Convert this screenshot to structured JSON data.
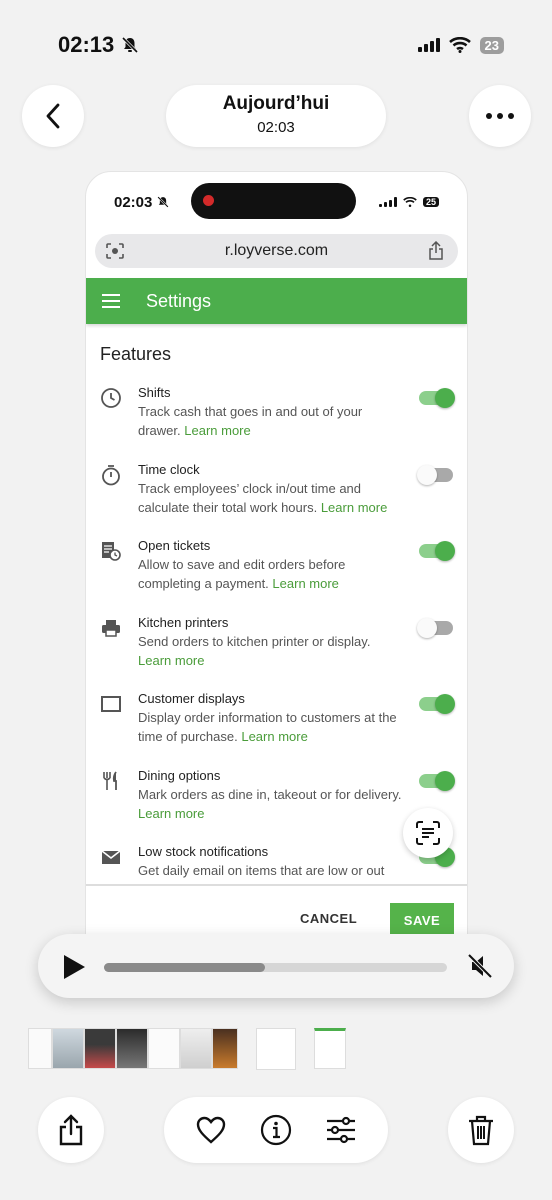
{
  "status_bar": {
    "time": "02:13",
    "battery": "23"
  },
  "header": {
    "title": "Aujourd’hui",
    "subtitle": "02:03"
  },
  "screenshot": {
    "status_bar": {
      "time": "02:03",
      "battery": "25"
    },
    "url": "r.loyverse.com",
    "appbar_title": "Settings",
    "section_title": "Features",
    "features": [
      {
        "name": "Shifts",
        "desc": "Track cash that goes in and out of your drawer.",
        "learn": "Learn more",
        "on": true,
        "icon": "clock-icon"
      },
      {
        "name": "Time clock",
        "desc": "Track employees’ clock in/out time and calculate their total work hours.",
        "learn": "Learn more",
        "on": false,
        "icon": "stopwatch-icon"
      },
      {
        "name": "Open tickets",
        "desc": "Allow to save and edit orders before completing a payment.",
        "learn": "Learn more",
        "on": true,
        "icon": "ticket-clock-icon"
      },
      {
        "name": "Kitchen printers",
        "desc": "Send orders to kitchen printer or display.",
        "learn": "Learn more",
        "on": false,
        "icon": "printer-icon"
      },
      {
        "name": "Customer displays",
        "desc": "Display order information to customers at the time of purchase.",
        "learn": "Learn more",
        "on": true,
        "icon": "display-icon"
      },
      {
        "name": "Dining options",
        "desc": "Mark orders as dine in, takeout or for delivery.",
        "learn": "Learn more",
        "on": true,
        "icon": "fork-knife-icon"
      },
      {
        "name": "Low stock notifications",
        "desc": "Get daily email on items that are low or out",
        "learn": "",
        "on": true,
        "icon": "mail-icon"
      }
    ],
    "cancel_label": "CANCEL",
    "save_label": "SAVE"
  },
  "player": {
    "progress": 0.47
  },
  "colors": {
    "accent": "#4cae4c",
    "link": "#4a9c3a"
  }
}
